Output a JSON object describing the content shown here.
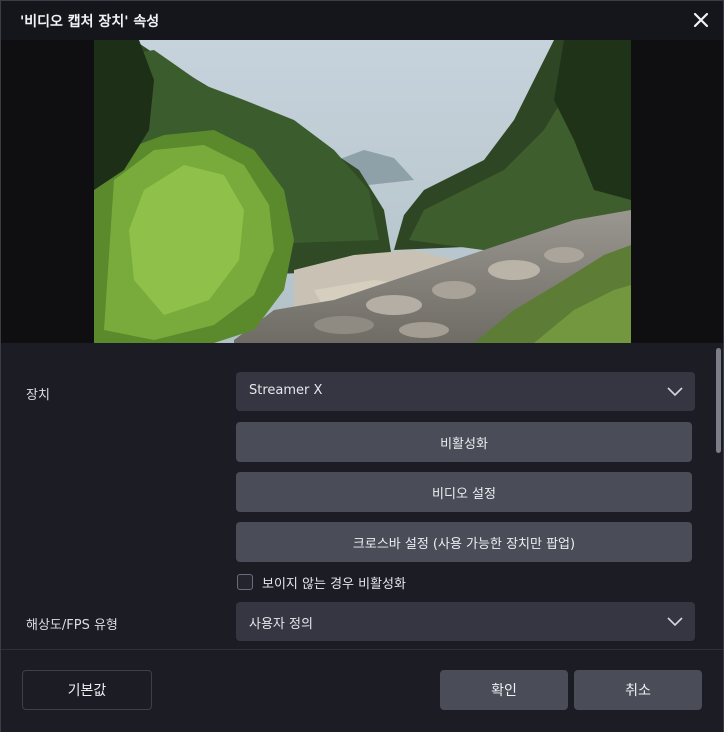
{
  "window": {
    "title": "'비디오 캡처 장치' 속성",
    "close_icon": "close-icon"
  },
  "preview": {
    "content": "video-preview-image"
  },
  "settings": {
    "device_label": "장치",
    "device_value": "Streamer X",
    "deactivate_button": "비활성화",
    "video_settings_button": "비디오 설정",
    "crossbar_settings_button": "크로스바 설정 (사용 가능한 장치만 팝업)",
    "deactivate_when_hidden_label": "보이지 않는 경우 비활성화",
    "deactivate_when_hidden_checked": false,
    "resolution_label": "해상도/FPS 유형",
    "resolution_value": "사용자 정의"
  },
  "footer": {
    "defaults_button": "기본값",
    "ok_button": "확인",
    "cancel_button": "취소"
  },
  "colors": {
    "titlebar": "#15161c",
    "background": "#1b1c24",
    "select_bg": "#353642",
    "button_bg": "#4a4c57"
  }
}
